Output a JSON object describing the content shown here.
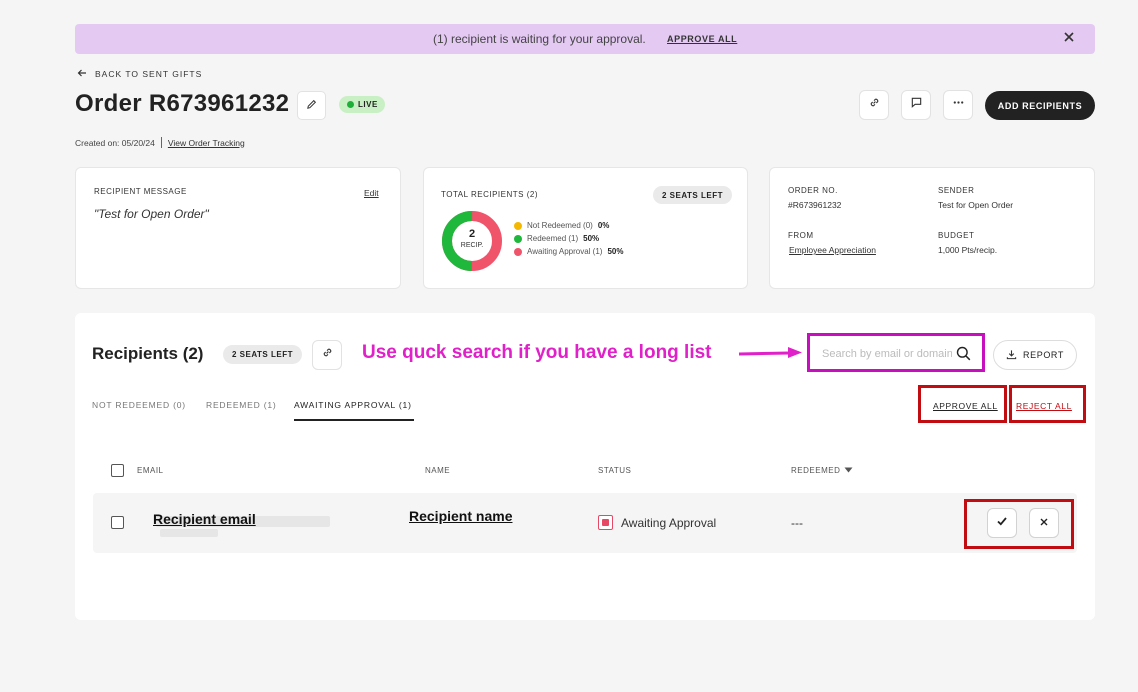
{
  "banner": {
    "message": "(1) recipient is waiting for your approval.",
    "link": "APPROVE ALL",
    "close_icon": "close-icon"
  },
  "header": {
    "back_label": "BACK TO SENT GIFTS",
    "title": "Order R673961232",
    "live_badge": "LIVE",
    "add_button": "ADD RECIPIENTS",
    "created_label": "Created on: 05/20/24",
    "tracking_link": "View Order Tracking"
  },
  "recipient_message_card": {
    "label": "RECIPIENT MESSAGE",
    "edit": "Edit",
    "message": "\"Test for Open Order\""
  },
  "total_card": {
    "label": "TOTAL RECIPIENTS (2)",
    "seats_badge": "2 SEATS LEFT",
    "donut_value": "2",
    "donut_unit": "RECIP.",
    "donut_fractions": {
      "redeemed": 0.5,
      "awaiting": 0.5,
      "not_redeemed": 0
    },
    "legend": [
      {
        "label": "Not Redeemed (0)",
        "pct": "0%",
        "color": "#f5b800"
      },
      {
        "label": "Redeemed (1)",
        "pct": "50%",
        "color": "#1fb83c"
      },
      {
        "label": "Awaiting Approval (1)",
        "pct": "50%",
        "color": "#f0546b"
      }
    ]
  },
  "order_card": {
    "order_no_label": "ORDER NO.",
    "order_no": "#R673961232",
    "sender_label": "SENDER",
    "sender": "Test for Open Order",
    "from_label": "FROM",
    "from": "Employee Appreciation",
    "budget_label": "BUDGET",
    "budget": "1,000 Pts/recip."
  },
  "recipients": {
    "title": "Recipients (2)",
    "seats_badge": "2 SEATS LEFT",
    "annotation": "Use quck search if you have a long list",
    "search_placeholder": "Search by email or domain",
    "report_button": "REPORT",
    "tabs": [
      {
        "label": "NOT REDEEMED (0)",
        "active": false
      },
      {
        "label": "REDEEMED (1)",
        "active": false
      },
      {
        "label": "AWAITING APPROVAL (1)",
        "active": true
      }
    ],
    "approve_all": "APPROVE ALL",
    "reject_all": "REJECT ALL",
    "columns": [
      "EMAIL",
      "NAME",
      "STATUS",
      "REDEEMED"
    ],
    "rows": [
      {
        "email_annotation": "Recipient email",
        "name_annotation": "Recipient name",
        "status": "Awaiting Approval",
        "redeemed": "---"
      }
    ]
  },
  "colors": {
    "accent_annotation": "#e020c8",
    "highlight_box": "#c10c12",
    "banner_bg": "#e4c9f3"
  }
}
